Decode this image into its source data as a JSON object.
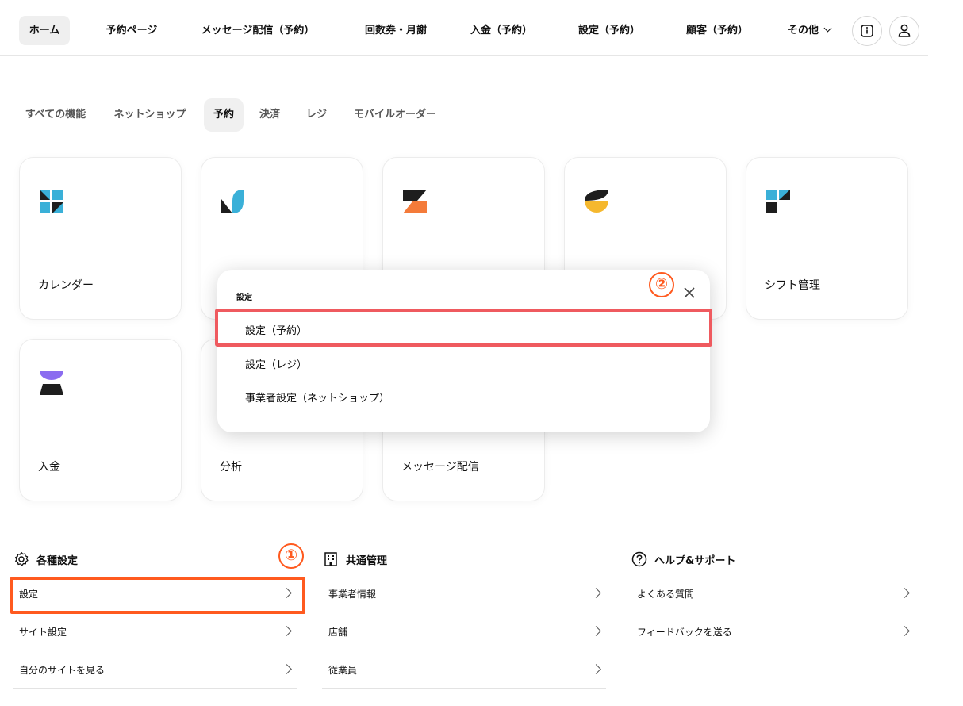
{
  "topnav": {
    "items": [
      {
        "label": "ホーム"
      },
      {
        "label": "予約ページ"
      },
      {
        "label": "メッセージ配信（予約）"
      },
      {
        "label": "回数券・月謝"
      },
      {
        "label": "入金（予約）"
      },
      {
        "label": "設定（予約）"
      },
      {
        "label": "顧客（予約）"
      },
      {
        "label": "その他"
      }
    ]
  },
  "filter_tabs": [
    "すべての機能",
    "ネットショップ",
    "予約",
    "決済",
    "レジ",
    "モバイルオーダー"
  ],
  "cards": [
    {
      "label": "カレンダー",
      "icon": "calendar-app-icon"
    },
    {
      "label": "",
      "icon": "k-app-icon"
    },
    {
      "label": "",
      "icon": "z-app-icon"
    },
    {
      "label": "",
      "icon": "half-circle-app-icon"
    },
    {
      "label": "シフト管理",
      "icon": "shift-app-icon"
    },
    {
      "label": "入金",
      "icon": "payment-app-icon"
    },
    {
      "label": "分析",
      "icon": "analytics-app-icon"
    },
    {
      "label": "メッセージ配信",
      "icon": "message-app-icon"
    }
  ],
  "popup": {
    "title": "設定",
    "items": [
      "設定（予約）",
      "設定（レジ）",
      "事業者設定（ネットショップ）"
    ]
  },
  "markers": {
    "one": "①",
    "two": "②"
  },
  "sections": {
    "settings": {
      "title": "各種設定",
      "items": [
        "設定",
        "サイト設定",
        "自分のサイトを見る"
      ]
    },
    "common": {
      "title": "共通管理",
      "items": [
        "事業者情報",
        "店舗",
        "従業員"
      ]
    },
    "help": {
      "title": "ヘルプ&サポート",
      "items": [
        "よくある質問",
        "フィードバックを送る"
      ]
    }
  },
  "colors": {
    "highlight_red": "#ef5a5f",
    "highlight_orange": "#ff5a1f"
  }
}
